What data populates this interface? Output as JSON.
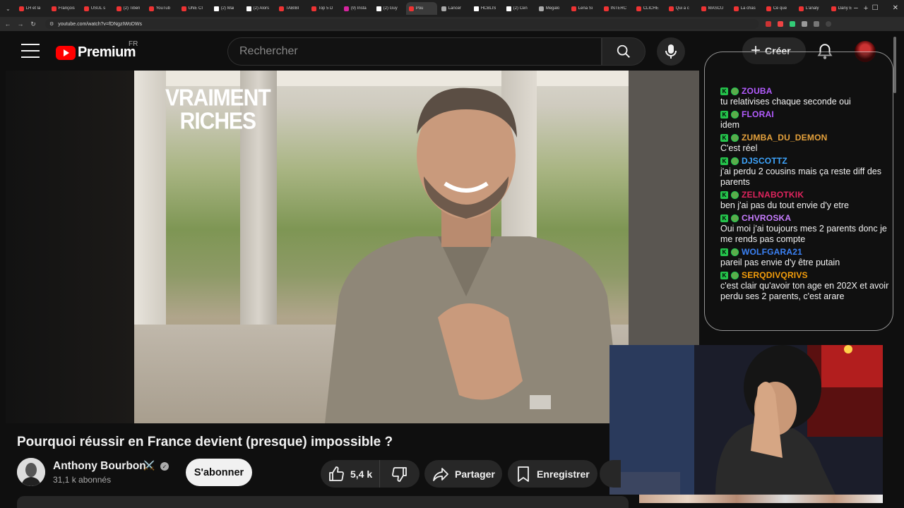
{
  "browser": {
    "tabs": [
      {
        "label": "LH et la",
        "icon": "youtube"
      },
      {
        "label": "François",
        "icon": "youtube"
      },
      {
        "label": "USUL s",
        "icon": "youtube"
      },
      {
        "label": "(2) Tiben",
        "icon": "youtube"
      },
      {
        "label": "YouTub",
        "icon": "youtube"
      },
      {
        "label": "UNE CI",
        "icon": "youtube"
      },
      {
        "label": "(2) Mai",
        "icon": "x"
      },
      {
        "label": "(2) Alors",
        "icon": "x"
      },
      {
        "label": "TABIBI",
        "icon": "youtube"
      },
      {
        "label": "Top 5 D",
        "icon": "youtube"
      },
      {
        "label": "(9) Insta",
        "icon": "instagram"
      },
      {
        "label": "(2) Guy",
        "icon": "x"
      },
      {
        "label": "Pou",
        "icon": "youtube"
      },
      {
        "label": "Lancer",
        "icon": "generic"
      },
      {
        "label": "HCBLIS",
        "icon": "x"
      },
      {
        "label": "(2) Cen",
        "icon": "x"
      },
      {
        "label": "Megalo",
        "icon": "generic"
      },
      {
        "label": "Lena Si",
        "icon": "youtube"
      },
      {
        "label": "INTERC",
        "icon": "youtube"
      },
      {
        "label": "CLICHE",
        "icon": "youtube"
      },
      {
        "label": "Qui a c",
        "icon": "youtube"
      },
      {
        "label": "MASCU",
        "icon": "youtube"
      },
      {
        "label": "La chas",
        "icon": "youtube"
      },
      {
        "label": "Ce que",
        "icon": "youtube"
      },
      {
        "label": "L'analy",
        "icon": "youtube"
      },
      {
        "label": "Dany E",
        "icon": "youtube"
      }
    ],
    "active_tab_index": 12,
    "url": "youtube.com/watch?v=fDNgzIWoDWs"
  },
  "header": {
    "brand": "Premium",
    "region": "FR",
    "search_placeholder": "Rechercher",
    "create_label": "Créer"
  },
  "video": {
    "overlay_title_line1": "VRAIMENT",
    "overlay_title_line2": "RICHES",
    "title": "Pourquoi réussir en France devient (presque) impossible ?"
  },
  "channel": {
    "name": "Anthony Bourbon",
    "emoji": "⚔️",
    "subscribers": "31,1 k abonnés",
    "subscribe_label": "S'abonner"
  },
  "actions": {
    "likes": "5,4 k",
    "share_label": "Partager",
    "save_label": "Enregistrer"
  },
  "chat": {
    "messages": [
      {
        "user": "ZOUBA",
        "color": "#b35cff",
        "text": "tu relativises chaque seconde oui"
      },
      {
        "user": "FLORAI",
        "color": "#b35cff",
        "text": "idem"
      },
      {
        "user": "ZUMBA_DU_DEMON",
        "color": "#e6a23c",
        "text": "C'est réel"
      },
      {
        "user": "DJSCOTTZ",
        "color": "#3ea6ff",
        "text": "j'ai perdu 2 cousins mais ça reste diff des parents"
      },
      {
        "user": "ZELNABOTKIK",
        "color": "#e0245e",
        "text": "ben j'ai pas du tout envie d'y etre"
      },
      {
        "user": "CHVROSKA",
        "color": "#c77dff",
        "text": "Oui moi j'ai toujours mes 2 parents donc je me rends pas compte"
      },
      {
        "user": "WOLFGARA21",
        "color": "#3b82f6",
        "text": "pareil pas envie d'y être putain"
      },
      {
        "user": "SERQDIVQRIVS",
        "color": "#f59e0b",
        "text": "c'est clair qu'avoir ton age en 202X et avoir perdu ses 2 parents, c'est arare"
      }
    ]
  }
}
